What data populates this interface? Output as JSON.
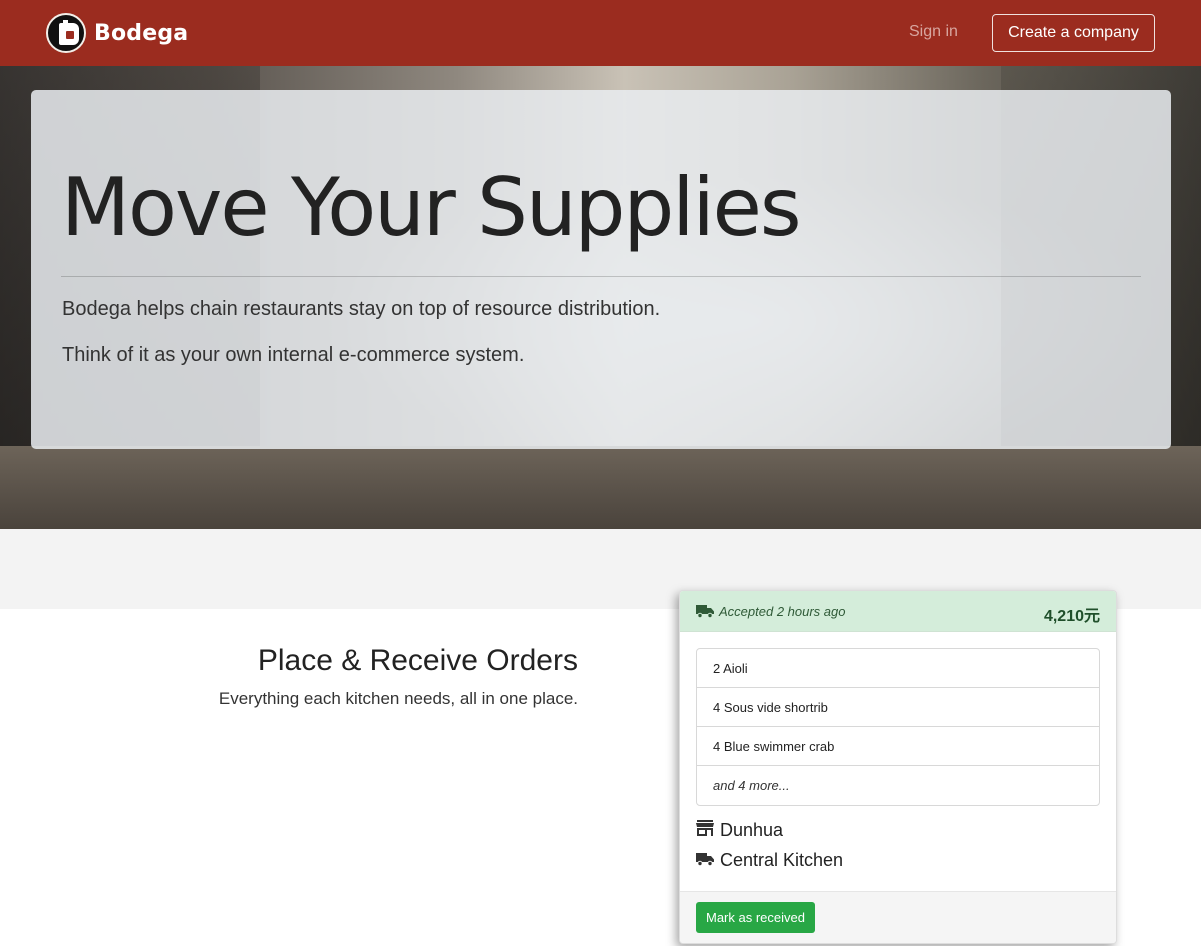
{
  "nav": {
    "brand_name": "Bodega",
    "sign_in": "Sign in",
    "create_company": "Create a company",
    "bar_color": "#9b2c1f"
  },
  "hero": {
    "title": "Move Your Supplies",
    "lead1": "Bodega helps chain restaurants stay on top of resource distribution.",
    "lead2": "Think of it as your own internal e-commerce system."
  },
  "feature": {
    "title": "Place & Receive Orders",
    "subtitle": "Everything each kitchen needs, all in one place."
  },
  "order_card": {
    "status_icon": "truck-icon",
    "status": "Accepted 2 hours ago",
    "amount": "4,210元",
    "items": [
      "2 Aioli",
      "4 Sous vide shortrib",
      "4 Blue swimmer crab"
    ],
    "more": "and 4 more...",
    "from_icon": "store-icon",
    "from": "Dunhua",
    "to_icon": "truck-icon",
    "to": "Central Kitchen",
    "action": "Mark as received",
    "header_color": "#d4edda",
    "action_color": "#28a745"
  }
}
